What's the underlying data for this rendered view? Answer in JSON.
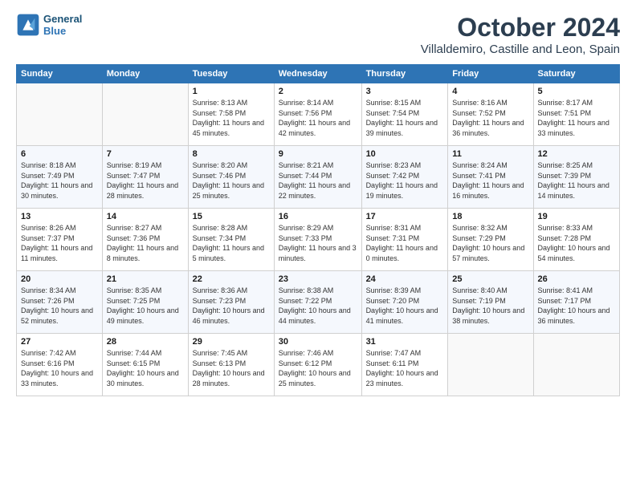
{
  "header": {
    "logo_line1": "General",
    "logo_line2": "Blue",
    "month": "October 2024",
    "location": "Villaldemiro, Castille and Leon, Spain"
  },
  "days_of_week": [
    "Sunday",
    "Monday",
    "Tuesday",
    "Wednesday",
    "Thursday",
    "Friday",
    "Saturday"
  ],
  "weeks": [
    [
      {
        "day": "",
        "info": ""
      },
      {
        "day": "",
        "info": ""
      },
      {
        "day": "1",
        "info": "Sunrise: 8:13 AM\nSunset: 7:58 PM\nDaylight: 11 hours and 45 minutes."
      },
      {
        "day": "2",
        "info": "Sunrise: 8:14 AM\nSunset: 7:56 PM\nDaylight: 11 hours and 42 minutes."
      },
      {
        "day": "3",
        "info": "Sunrise: 8:15 AM\nSunset: 7:54 PM\nDaylight: 11 hours and 39 minutes."
      },
      {
        "day": "4",
        "info": "Sunrise: 8:16 AM\nSunset: 7:52 PM\nDaylight: 11 hours and 36 minutes."
      },
      {
        "day": "5",
        "info": "Sunrise: 8:17 AM\nSunset: 7:51 PM\nDaylight: 11 hours and 33 minutes."
      }
    ],
    [
      {
        "day": "6",
        "info": "Sunrise: 8:18 AM\nSunset: 7:49 PM\nDaylight: 11 hours and 30 minutes."
      },
      {
        "day": "7",
        "info": "Sunrise: 8:19 AM\nSunset: 7:47 PM\nDaylight: 11 hours and 28 minutes."
      },
      {
        "day": "8",
        "info": "Sunrise: 8:20 AM\nSunset: 7:46 PM\nDaylight: 11 hours and 25 minutes."
      },
      {
        "day": "9",
        "info": "Sunrise: 8:21 AM\nSunset: 7:44 PM\nDaylight: 11 hours and 22 minutes."
      },
      {
        "day": "10",
        "info": "Sunrise: 8:23 AM\nSunset: 7:42 PM\nDaylight: 11 hours and 19 minutes."
      },
      {
        "day": "11",
        "info": "Sunrise: 8:24 AM\nSunset: 7:41 PM\nDaylight: 11 hours and 16 minutes."
      },
      {
        "day": "12",
        "info": "Sunrise: 8:25 AM\nSunset: 7:39 PM\nDaylight: 11 hours and 14 minutes."
      }
    ],
    [
      {
        "day": "13",
        "info": "Sunrise: 8:26 AM\nSunset: 7:37 PM\nDaylight: 11 hours and 11 minutes."
      },
      {
        "day": "14",
        "info": "Sunrise: 8:27 AM\nSunset: 7:36 PM\nDaylight: 11 hours and 8 minutes."
      },
      {
        "day": "15",
        "info": "Sunrise: 8:28 AM\nSunset: 7:34 PM\nDaylight: 11 hours and 5 minutes."
      },
      {
        "day": "16",
        "info": "Sunrise: 8:29 AM\nSunset: 7:33 PM\nDaylight: 11 hours and 3 minutes."
      },
      {
        "day": "17",
        "info": "Sunrise: 8:31 AM\nSunset: 7:31 PM\nDaylight: 11 hours and 0 minutes."
      },
      {
        "day": "18",
        "info": "Sunrise: 8:32 AM\nSunset: 7:29 PM\nDaylight: 10 hours and 57 minutes."
      },
      {
        "day": "19",
        "info": "Sunrise: 8:33 AM\nSunset: 7:28 PM\nDaylight: 10 hours and 54 minutes."
      }
    ],
    [
      {
        "day": "20",
        "info": "Sunrise: 8:34 AM\nSunset: 7:26 PM\nDaylight: 10 hours and 52 minutes."
      },
      {
        "day": "21",
        "info": "Sunrise: 8:35 AM\nSunset: 7:25 PM\nDaylight: 10 hours and 49 minutes."
      },
      {
        "day": "22",
        "info": "Sunrise: 8:36 AM\nSunset: 7:23 PM\nDaylight: 10 hours and 46 minutes."
      },
      {
        "day": "23",
        "info": "Sunrise: 8:38 AM\nSunset: 7:22 PM\nDaylight: 10 hours and 44 minutes."
      },
      {
        "day": "24",
        "info": "Sunrise: 8:39 AM\nSunset: 7:20 PM\nDaylight: 10 hours and 41 minutes."
      },
      {
        "day": "25",
        "info": "Sunrise: 8:40 AM\nSunset: 7:19 PM\nDaylight: 10 hours and 38 minutes."
      },
      {
        "day": "26",
        "info": "Sunrise: 8:41 AM\nSunset: 7:17 PM\nDaylight: 10 hours and 36 minutes."
      }
    ],
    [
      {
        "day": "27",
        "info": "Sunrise: 7:42 AM\nSunset: 6:16 PM\nDaylight: 10 hours and 33 minutes."
      },
      {
        "day": "28",
        "info": "Sunrise: 7:44 AM\nSunset: 6:15 PM\nDaylight: 10 hours and 30 minutes."
      },
      {
        "day": "29",
        "info": "Sunrise: 7:45 AM\nSunset: 6:13 PM\nDaylight: 10 hours and 28 minutes."
      },
      {
        "day": "30",
        "info": "Sunrise: 7:46 AM\nSunset: 6:12 PM\nDaylight: 10 hours and 25 minutes."
      },
      {
        "day": "31",
        "info": "Sunrise: 7:47 AM\nSunset: 6:11 PM\nDaylight: 10 hours and 23 minutes."
      },
      {
        "day": "",
        "info": ""
      },
      {
        "day": "",
        "info": ""
      }
    ]
  ]
}
